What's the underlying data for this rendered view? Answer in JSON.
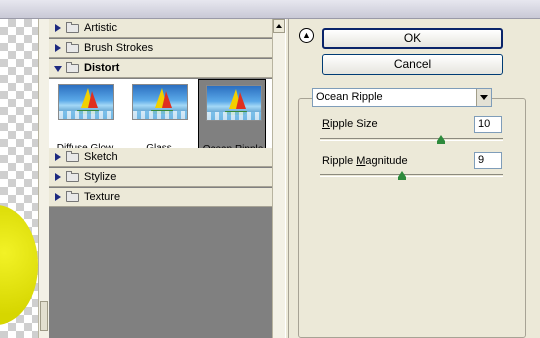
{
  "gallery": {
    "categories_top": [
      {
        "label": "Artistic",
        "open": false
      },
      {
        "label": "Brush Strokes",
        "open": false
      },
      {
        "label": "Distort",
        "open": true
      }
    ],
    "thumbnails": [
      {
        "label": "Diffuse Glow",
        "selected": false
      },
      {
        "label": "Glass",
        "selected": false
      },
      {
        "label": "Ocean Ripple",
        "selected": true
      }
    ],
    "categories_bottom": [
      {
        "label": "Sketch",
        "open": false
      },
      {
        "label": "Stylize",
        "open": false
      },
      {
        "label": "Texture",
        "open": false
      }
    ]
  },
  "buttons": {
    "ok": "OK",
    "cancel": "Cancel",
    "collapse_icon": "double-chevron-up-icon"
  },
  "filter": {
    "selected": "Ocean Ripple",
    "params": [
      {
        "label_prefix": "",
        "mnemonic": "R",
        "label_rest": "ipple Size",
        "value": "10",
        "slider_fraction": 0.66
      },
      {
        "label_prefix": "Ripple ",
        "mnemonic": "M",
        "label_rest": "agnitude",
        "value": "9",
        "slider_fraction": 0.45
      }
    ]
  },
  "colors": {
    "panel": "#ece9d8",
    "gallery_bg": "#808080",
    "accent": "#0a246a"
  }
}
